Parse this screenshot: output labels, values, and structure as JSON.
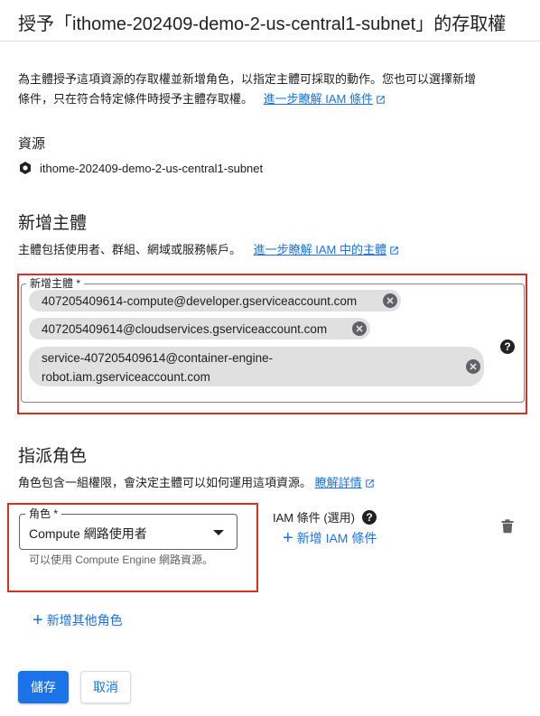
{
  "header": {
    "title": "授予「ithome-202409-demo-2-us-central1-subnet」的存取權"
  },
  "intro": {
    "line1": "為主體授予這項資源的存取權並新增角色，以指定主體可採取的動作。您也可以選擇新增",
    "line2": "條件，只在符合特定條件時授予主體存取權。",
    "link": "進一步瞭解 IAM 條件"
  },
  "resource": {
    "label": "資源",
    "name": "ithome-202409-demo-2-us-central1-subnet",
    "icon": "subnet-hexagon-icon"
  },
  "add_members": {
    "title": "新增主體",
    "description": "主體包括使用者、群組、網域或服務帳戶。",
    "link": "進一步瞭解 IAM 中的主體",
    "field_label": "新增主體 *",
    "chips": [
      "407205409614-compute@developer.gserviceaccount.com",
      "407205409614@cloudservices.gserviceaccount.com",
      "service-407205409614@container-engine-robot.iam.gserviceaccount.com"
    ],
    "chip3_line1": "service-407205409614@container-engine-",
    "chip3_line2": "robot.iam.gserviceaccount.com",
    "help": "?"
  },
  "assign_roles": {
    "title": "指派角色",
    "description": "角色包含一組權限，會決定主體可以如何運用這項資源。",
    "link": "瞭解詳情",
    "role_label": "角色 *",
    "role_value": "Compute 網路使用者",
    "role_hint": "可以使用 Compute Engine 網路資源。",
    "condition_label": "IAM 條件 (選用)",
    "add_condition": "新增 IAM 條件",
    "add_role": "新增其他角色"
  },
  "actions": {
    "save": "儲存",
    "cancel": "取消"
  },
  "colors": {
    "primary": "#1a73e8",
    "highlight": "#d93025"
  }
}
